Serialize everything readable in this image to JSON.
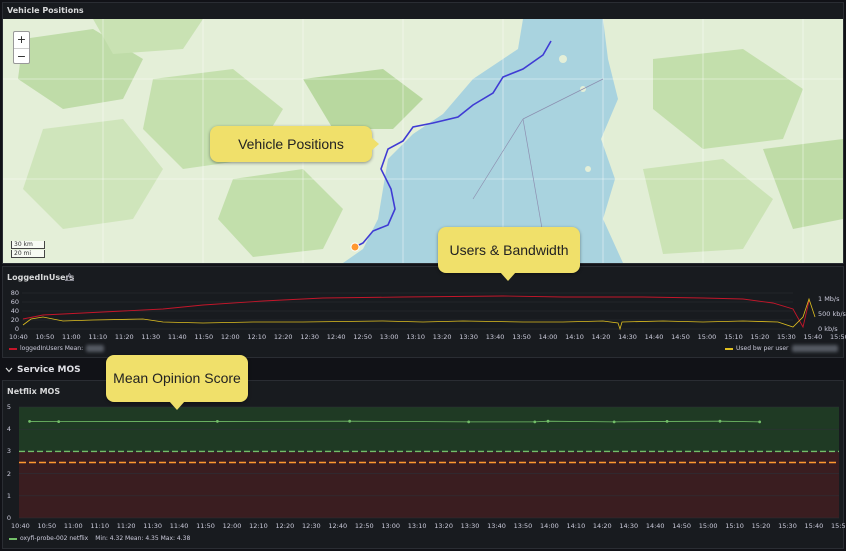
{
  "map_panel": {
    "title": "Vehicle Positions",
    "zoom_in": "+",
    "zoom_out": "−",
    "scale_km": "30 km",
    "scale_mi": "20 mi"
  },
  "callouts": {
    "vehicle": "Vehicle Positions",
    "users": "Users & Bandwidth",
    "mos": "Mean Opinion Score"
  },
  "users_panel": {
    "title": "LoggedInUsers",
    "warning_icon": "warning-triangle-icon",
    "y_ticks": [
      "80",
      "60",
      "40",
      "20",
      "0"
    ],
    "y2_ticks": [
      "1 Mb/s",
      "500 kb/s",
      "0 kb/s"
    ],
    "x_ticks": [
      "10:40",
      "10:50",
      "11:00",
      "11:10",
      "11:20",
      "11:30",
      "11:40",
      "11:50",
      "12:00",
      "12:10",
      "12:20",
      "12:30",
      "12:40",
      "12:50",
      "13:00",
      "13:10",
      "13:20",
      "13:30",
      "13:40",
      "13:50",
      "14:00",
      "14:10",
      "14:20",
      "14:30",
      "14:40",
      "14:50",
      "15:00",
      "15:10",
      "15:20",
      "15:30",
      "15:40",
      "15:50"
    ],
    "legend_left": "loggedInUsers  Mean:",
    "legend_right": "Used bw per user",
    "colors": {
      "users": "#c4162a",
      "bandwidth": "#e0c020"
    }
  },
  "section": {
    "title": "Service MOS",
    "chevron": "chevron-down-icon"
  },
  "mos_panel": {
    "title": "Netflix MOS",
    "y_ticks": [
      "5",
      "4",
      "3",
      "2",
      "1",
      "0"
    ],
    "x_ticks": [
      "10:40",
      "10:50",
      "11:00",
      "11:10",
      "11:20",
      "11:30",
      "11:40",
      "11:50",
      "12:00",
      "12:10",
      "12:20",
      "12:30",
      "12:40",
      "12:50",
      "13:00",
      "13:10",
      "13:20",
      "13:30",
      "13:40",
      "13:50",
      "14:00",
      "14:10",
      "14:20",
      "14:30",
      "14:40",
      "14:50",
      "15:00",
      "15:10",
      "15:20",
      "15:30",
      "15:40",
      "15:50"
    ],
    "legend": "oxyfi-probe-002 netflix",
    "stats": "Min: 4.32   Mean: 4.35   Max: 4.38",
    "colors": {
      "good": "#1f3a24",
      "bad": "#3a1d20",
      "green_line": "#73bf69",
      "orange_line": "#ff9830",
      "series": "#73bf69"
    }
  },
  "chart_data": [
    {
      "type": "line",
      "title": "Netflix MOS",
      "x": [
        "10:44",
        "10:55",
        "11:55",
        "12:45",
        "13:30",
        "13:55",
        "14:00",
        "14:25",
        "14:45",
        "15:05",
        "15:20"
      ],
      "series": [
        {
          "name": "oxyfi-probe-002 netflix",
          "values": [
            4.35,
            4.34,
            4.35,
            4.36,
            4.33,
            4.33,
            4.36,
            4.33,
            4.35,
            4.36,
            4.33
          ]
        }
      ],
      "ylim": [
        0,
        5
      ],
      "thresholds": [
        3,
        2.5
      ]
    }
  ]
}
